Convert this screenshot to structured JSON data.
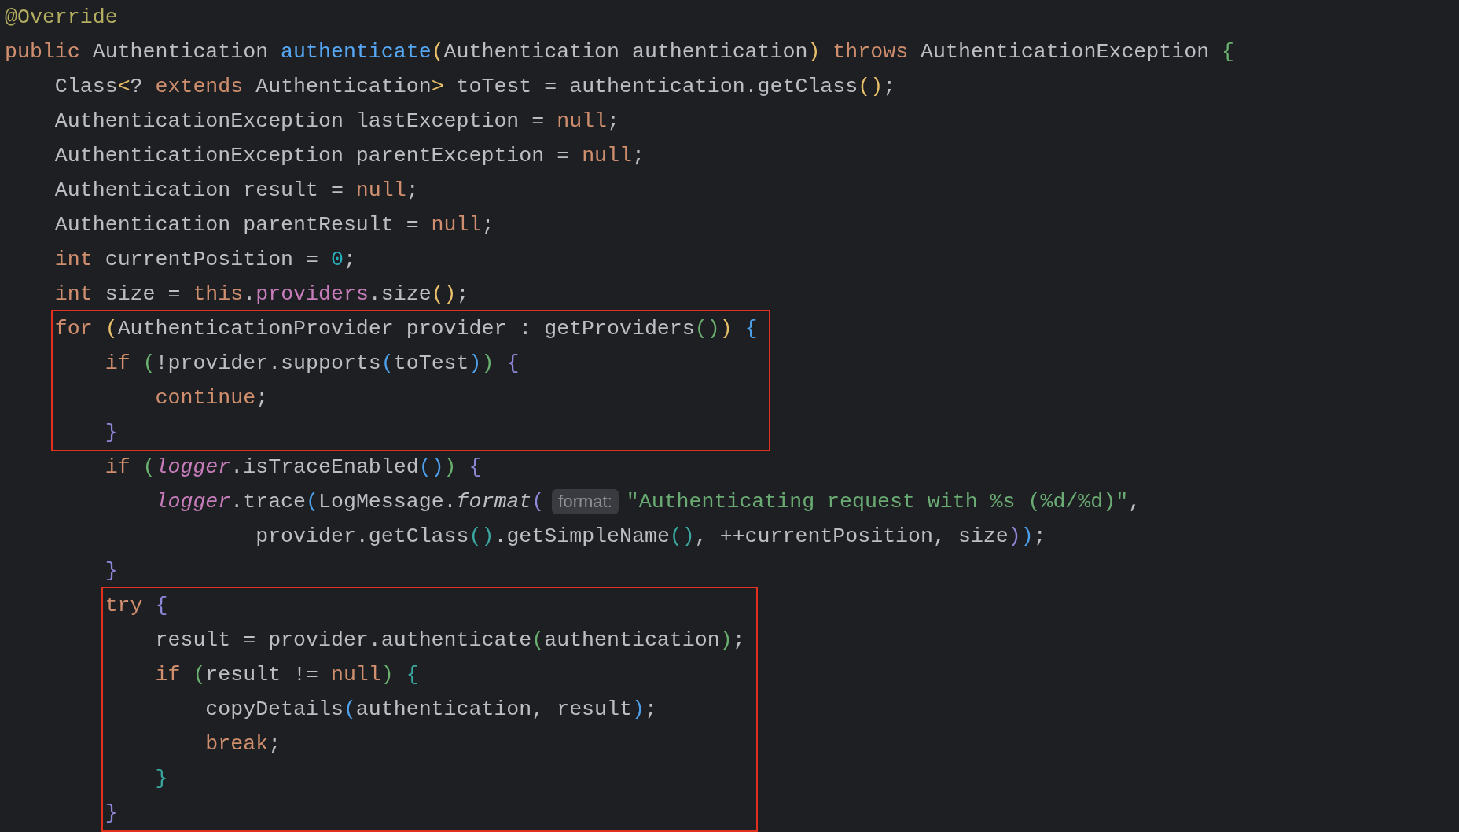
{
  "blocks": [
    {
      "highlighted": false,
      "lines": [
        [
          {
            "kind": "annotation",
            "text": "@Override"
          }
        ],
        [
          {
            "kind": "keyword",
            "text": "public"
          },
          {
            "kind": "plain",
            "text": " Authentication "
          },
          {
            "kind": "declaration",
            "text": "authenticate"
          },
          {
            "kind": "bracket",
            "text": "(",
            "color": "#e8bf6a"
          },
          {
            "kind": "plain",
            "text": "Authentication authentication"
          },
          {
            "kind": "bracket",
            "text": ")",
            "color": "#e8bf6a"
          },
          {
            "kind": "keyword",
            "text": " throws"
          },
          {
            "kind": "plain",
            "text": " AuthenticationException "
          },
          {
            "kind": "bracket",
            "text": "{",
            "color": "#6ab06f"
          }
        ],
        [
          {
            "kind": "plain",
            "text": "    Class"
          },
          {
            "kind": "bracket",
            "text": "<",
            "color": "#e8bf6a"
          },
          {
            "kind": "plain",
            "text": "? "
          },
          {
            "kind": "keyword",
            "text": "extends"
          },
          {
            "kind": "plain",
            "text": " Authentication"
          },
          {
            "kind": "bracket",
            "text": ">",
            "color": "#e8bf6a"
          },
          {
            "kind": "plain",
            "text": " toTest = authentication.getClass"
          },
          {
            "kind": "bracket",
            "text": "()",
            "color": "#e8bf6a"
          },
          {
            "kind": "plain",
            "text": ";"
          }
        ],
        [
          {
            "kind": "plain",
            "text": "    AuthenticationException lastException = "
          },
          {
            "kind": "keyword",
            "text": "null"
          },
          {
            "kind": "plain",
            "text": ";"
          }
        ],
        [
          {
            "kind": "plain",
            "text": "    AuthenticationException parentException = "
          },
          {
            "kind": "keyword",
            "text": "null"
          },
          {
            "kind": "plain",
            "text": ";"
          }
        ],
        [
          {
            "kind": "plain",
            "text": "    Authentication result = "
          },
          {
            "kind": "keyword",
            "text": "null"
          },
          {
            "kind": "plain",
            "text": ";"
          }
        ],
        [
          {
            "kind": "plain",
            "text": "    Authentication parentResult = "
          },
          {
            "kind": "keyword",
            "text": "null"
          },
          {
            "kind": "plain",
            "text": ";"
          }
        ],
        [
          {
            "kind": "keyword",
            "text": "    int"
          },
          {
            "kind": "plain",
            "text": " currentPosition = "
          },
          {
            "kind": "number",
            "text": "0"
          },
          {
            "kind": "plain",
            "text": ";"
          }
        ],
        [
          {
            "kind": "keyword",
            "text": "    int"
          },
          {
            "kind": "plain",
            "text": " size = "
          },
          {
            "kind": "keyword",
            "text": "this"
          },
          {
            "kind": "plain",
            "text": "."
          },
          {
            "kind": "field",
            "text": "providers"
          },
          {
            "kind": "plain",
            "text": ".size"
          },
          {
            "kind": "bracket",
            "text": "()",
            "color": "#e8bf6a"
          },
          {
            "kind": "plain",
            "text": ";"
          }
        ]
      ]
    },
    {
      "highlighted": true,
      "lines": [
        [
          {
            "kind": "keyword",
            "text": "    for "
          },
          {
            "kind": "bracket",
            "text": "(",
            "color": "#e8bf6a"
          },
          {
            "kind": "plain",
            "text": "AuthenticationProvider provider : getProviders"
          },
          {
            "kind": "bracket",
            "text": "()",
            "color": "#6ab06f"
          },
          {
            "kind": "bracket",
            "text": ")",
            "color": "#e8bf6a"
          },
          {
            "kind": "bracket",
            "text": " {",
            "color": "#4c9fe8"
          }
        ],
        [
          {
            "kind": "keyword",
            "text": "        if "
          },
          {
            "kind": "bracket",
            "text": "(",
            "color": "#6ab06f"
          },
          {
            "kind": "plain",
            "text": "!provider.supports"
          },
          {
            "kind": "bracket",
            "text": "(",
            "color": "#4c9fe8"
          },
          {
            "kind": "plain",
            "text": "toTest"
          },
          {
            "kind": "bracket",
            "text": ")",
            "color": "#4c9fe8"
          },
          {
            "kind": "bracket",
            "text": ")",
            "color": "#6ab06f"
          },
          {
            "kind": "bracket",
            "text": " {",
            "color": "#8d87d8"
          }
        ],
        [
          {
            "kind": "keyword",
            "text": "            continue"
          },
          {
            "kind": "plain",
            "text": ";"
          }
        ],
        [
          {
            "kind": "bracket",
            "text": "        }",
            "color": "#8d87d8"
          }
        ]
      ]
    },
    {
      "highlighted": false,
      "lines": [
        [
          {
            "kind": "keyword",
            "text": "        if "
          },
          {
            "kind": "bracket",
            "text": "(",
            "color": "#6ab06f"
          },
          {
            "kind": "static",
            "text": "logger"
          },
          {
            "kind": "plain",
            "text": ".isTraceEnabled"
          },
          {
            "kind": "bracket",
            "text": "()",
            "color": "#4c9fe8"
          },
          {
            "kind": "bracket",
            "text": ")",
            "color": "#6ab06f"
          },
          {
            "kind": "bracket",
            "text": " {",
            "color": "#8d87d8"
          }
        ],
        [
          {
            "kind": "static",
            "text": "            logger"
          },
          {
            "kind": "plain",
            "text": ".trace"
          },
          {
            "kind": "bracket",
            "text": "(",
            "color": "#4c9fe8"
          },
          {
            "kind": "plain",
            "text": "LogMessage."
          },
          {
            "kind": "static_method",
            "text": "format"
          },
          {
            "kind": "bracket",
            "text": "(",
            "color": "#8d87d8"
          },
          {
            "kind": "hint",
            "text": "format:"
          },
          {
            "kind": "string",
            "text": "\"Authenticating request with %s (%d/%d)\""
          },
          {
            "kind": "plain",
            "text": ","
          }
        ],
        [
          {
            "kind": "plain",
            "text": "                    provider.getClass"
          },
          {
            "kind": "bracket",
            "text": "()",
            "color": "#3aa7a0"
          },
          {
            "kind": "plain",
            "text": ".getSimpleName"
          },
          {
            "kind": "bracket",
            "text": "()",
            "color": "#3aa7a0"
          },
          {
            "kind": "plain",
            "text": ", ++currentPosition, size"
          },
          {
            "kind": "bracket",
            "text": ")",
            "color": "#8d87d8"
          },
          {
            "kind": "bracket",
            "text": ")",
            "color": "#4c9fe8"
          },
          {
            "kind": "plain",
            "text": ";"
          }
        ],
        [
          {
            "kind": "bracket",
            "text": "        }",
            "color": "#8d87d8"
          }
        ]
      ]
    },
    {
      "highlighted": true,
      "lines": [
        [
          {
            "kind": "keyword",
            "text": "        try "
          },
          {
            "kind": "bracket",
            "text": "{",
            "color": "#8d87d8"
          }
        ],
        [
          {
            "kind": "plain",
            "text": "            result = provider.authenticate"
          },
          {
            "kind": "bracket",
            "text": "(",
            "color": "#6ab06f"
          },
          {
            "kind": "plain",
            "text": "authentication"
          },
          {
            "kind": "bracket",
            "text": ")",
            "color": "#6ab06f"
          },
          {
            "kind": "plain",
            "text": ";"
          }
        ],
        [
          {
            "kind": "keyword",
            "text": "            if "
          },
          {
            "kind": "bracket",
            "text": "(",
            "color": "#6ab06f"
          },
          {
            "kind": "plain",
            "text": "result != "
          },
          {
            "kind": "keyword",
            "text": "null"
          },
          {
            "kind": "bracket",
            "text": ")",
            "color": "#6ab06f"
          },
          {
            "kind": "bracket",
            "text": " {",
            "color": "#3aa7a0"
          }
        ],
        [
          {
            "kind": "plain",
            "text": "                copyDetails"
          },
          {
            "kind": "bracket",
            "text": "(",
            "color": "#4c9fe8"
          },
          {
            "kind": "plain",
            "text": "authentication, result"
          },
          {
            "kind": "bracket",
            "text": ")",
            "color": "#4c9fe8"
          },
          {
            "kind": "plain",
            "text": ";"
          }
        ],
        [
          {
            "kind": "keyword",
            "text": "                break"
          },
          {
            "kind": "plain",
            "text": ";"
          }
        ],
        [
          {
            "kind": "bracket",
            "text": "            }",
            "color": "#3aa7a0"
          }
        ],
        [
          {
            "kind": "bracket",
            "text": "        }",
            "color": "#8d87d8"
          }
        ]
      ]
    }
  ]
}
